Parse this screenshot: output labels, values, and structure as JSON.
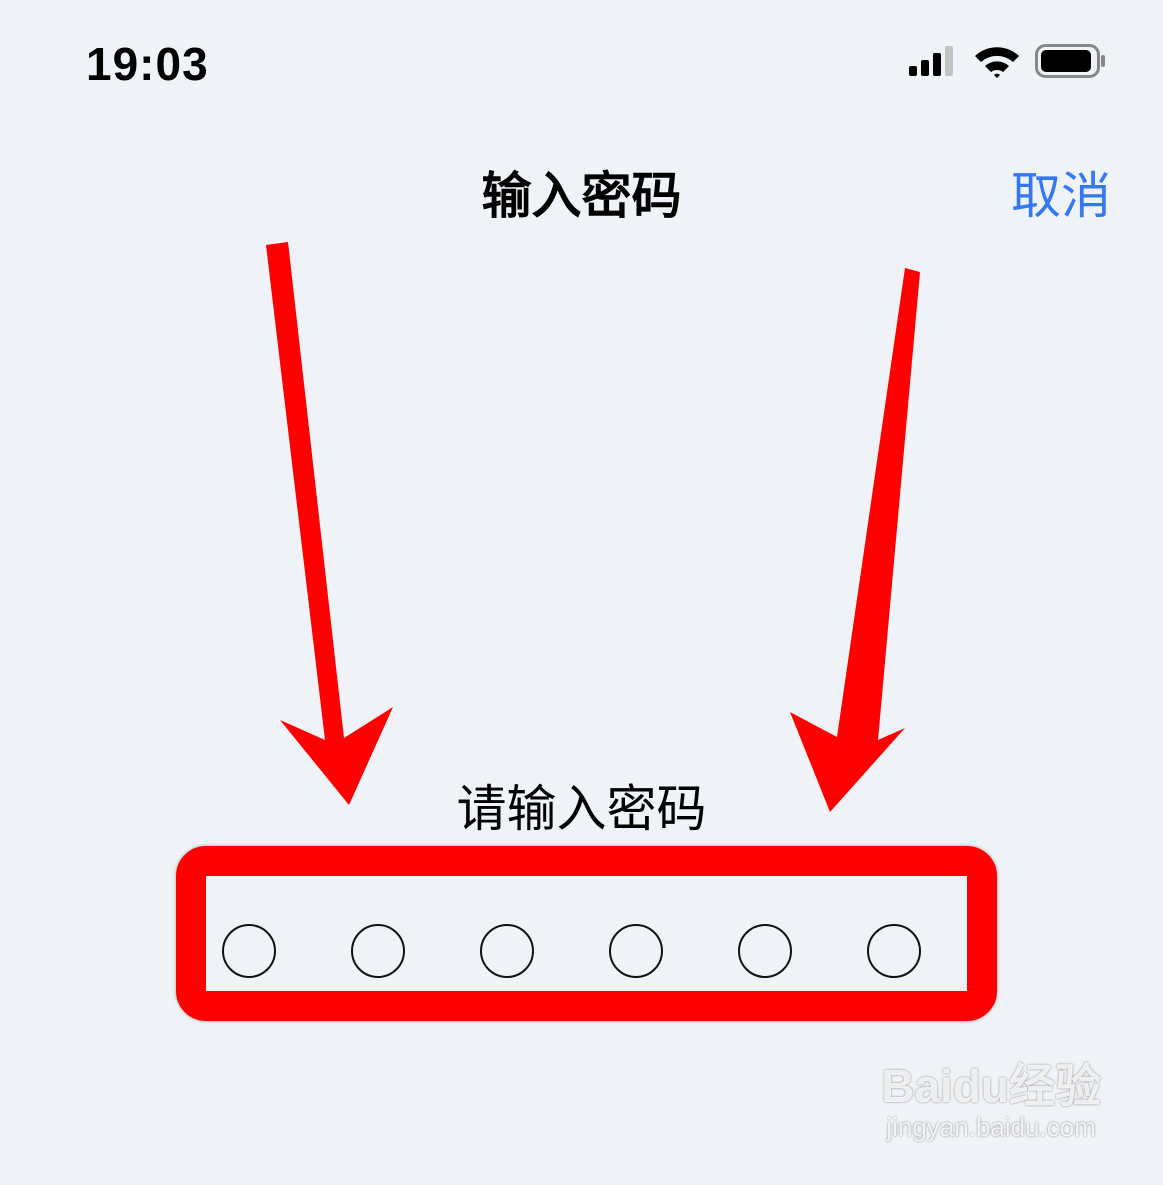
{
  "status_bar": {
    "time": "19:03",
    "icons": [
      "cellular-signal-icon",
      "wifi-icon",
      "battery-icon"
    ]
  },
  "header": {
    "title": "输入密码",
    "cancel_label": "取消"
  },
  "main": {
    "prompt": "请输入密码",
    "pin_length": 6
  },
  "annotations": {
    "highlight_color": "#ff0000"
  },
  "watermark": {
    "logo": "Baidu经验",
    "url": "jingyan.baidu.com"
  },
  "colors": {
    "background": "#eff2f6",
    "accent": "#3478f6"
  }
}
